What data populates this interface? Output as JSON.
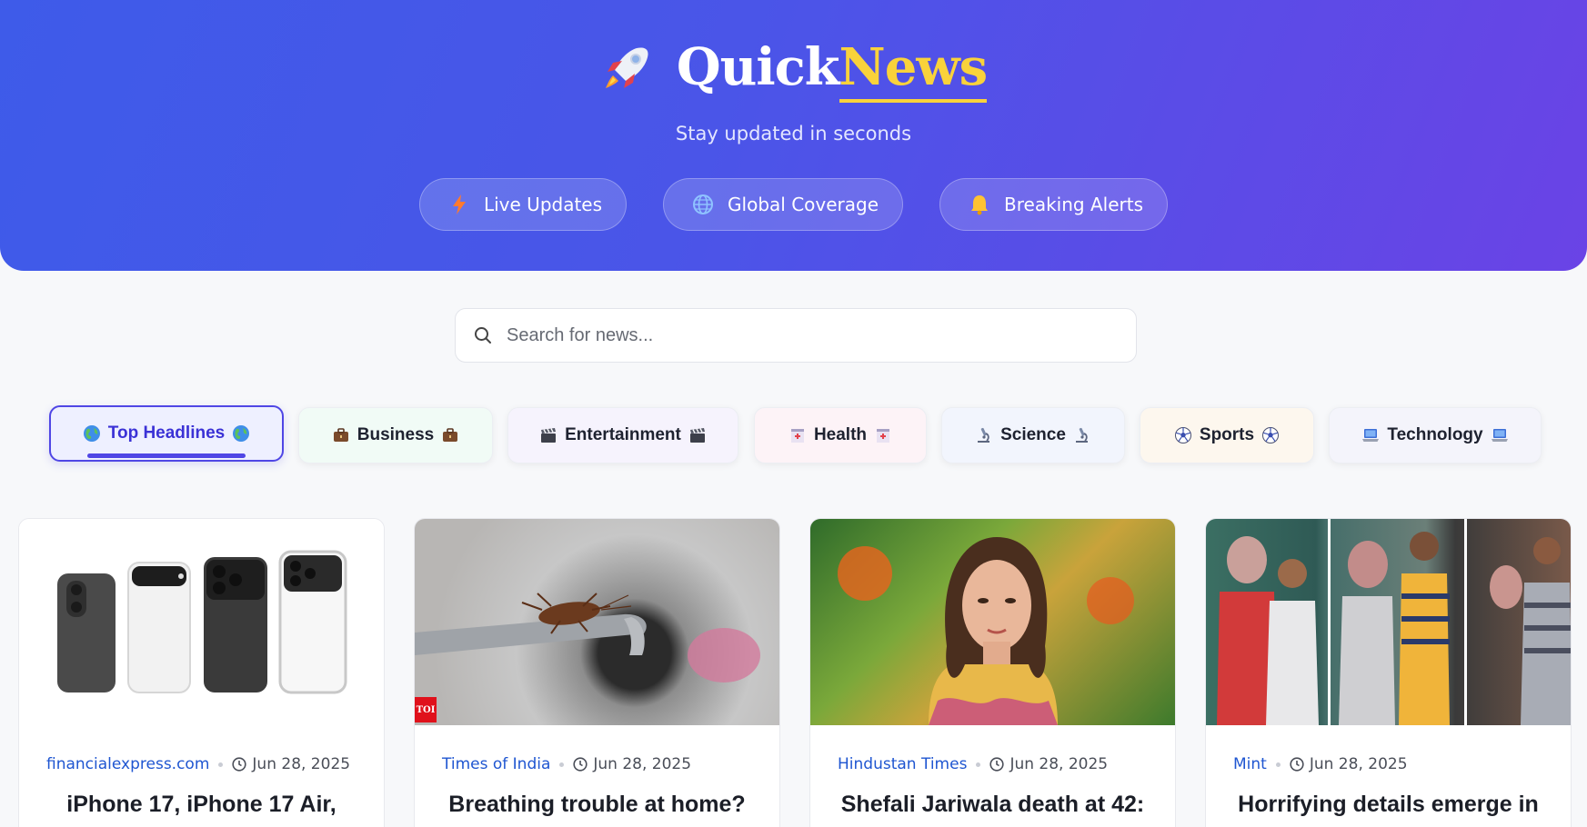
{
  "header": {
    "logo_main": "Quick",
    "logo_accent": "News",
    "tagline": "Stay updated in seconds",
    "features": [
      {
        "label": "Live Updates",
        "icon": "lightning-icon"
      },
      {
        "label": "Global Coverage",
        "icon": "globe-icon"
      },
      {
        "label": "Breaking Alerts",
        "icon": "bell-icon"
      }
    ]
  },
  "search": {
    "placeholder": "Search for news..."
  },
  "categories": [
    {
      "label": "Top Headlines",
      "icon": "earth-icon",
      "active": true
    },
    {
      "label": "Business",
      "icon": "briefcase-icon"
    },
    {
      "label": "Entertainment",
      "icon": "clapper-icon"
    },
    {
      "label": "Health",
      "icon": "hospital-icon"
    },
    {
      "label": "Science",
      "icon": "microscope-icon"
    },
    {
      "label": "Sports",
      "icon": "soccer-ball-icon"
    },
    {
      "label": "Technology",
      "icon": "laptop-icon"
    }
  ],
  "articles": [
    {
      "source": "financialexpress.com",
      "date": "Jun 28, 2025",
      "title": "iPhone 17, iPhone 17 Air,"
    },
    {
      "source": "Times of India",
      "date": "Jun 28, 2025",
      "title": "Breathing trouble at home?",
      "badge": "TOI"
    },
    {
      "source": "Hindustan Times",
      "date": "Jun 28, 2025",
      "title": "Shefali Jariwala death at 42:"
    },
    {
      "source": "Mint",
      "date": "Jun 28, 2025",
      "title": "Horrifying details emerge in"
    }
  ],
  "colors": {
    "accent": "#4f46e5",
    "logo_accent": "#f9d23b",
    "source_link": "#1f56d1"
  }
}
